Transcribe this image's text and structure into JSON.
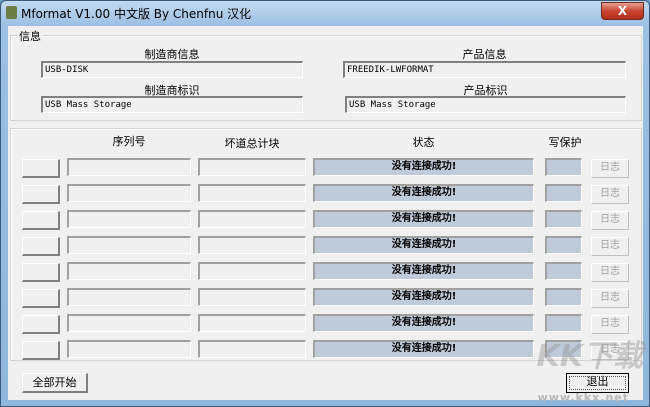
{
  "window": {
    "title": "Mformat V1.00 中文版 By Chenfnu 汉化",
    "close": "X"
  },
  "info": {
    "group_label": "信息",
    "manufacturer_info_label": "制造商信息",
    "manufacturer_info": "USB-DISK",
    "product_info_label": "产品信息",
    "product_info": "FREEDIK-LWFORMAT",
    "manufacturer_id_label": "制造商标识",
    "manufacturer_id": "USB Mass Storage",
    "product_id_label": "产品标识",
    "product_id": "USB Mass Storage"
  },
  "drives": {
    "headers": {
      "serial": "序列号",
      "bad_blocks": "坏道总计块",
      "status": "状态",
      "write_protect": "写保护"
    },
    "rows": [
      {
        "status": "没有连接成功!",
        "log": "日志"
      },
      {
        "status": "没有连接成功!",
        "log": "日志"
      },
      {
        "status": "没有连接成功!",
        "log": "日志"
      },
      {
        "status": "没有连接成功!",
        "log": "日志"
      },
      {
        "status": "没有连接成功!",
        "log": "日志"
      },
      {
        "status": "没有连接成功!",
        "log": "日志"
      },
      {
        "status": "没有连接成功!",
        "log": "日志"
      },
      {
        "status": "没有连接成功!",
        "log": "日志"
      }
    ]
  },
  "buttons": {
    "start_all": "全部开始",
    "exit": "退出"
  },
  "watermark": {
    "logo": "KK下载",
    "url": "www.kkx.net"
  }
}
